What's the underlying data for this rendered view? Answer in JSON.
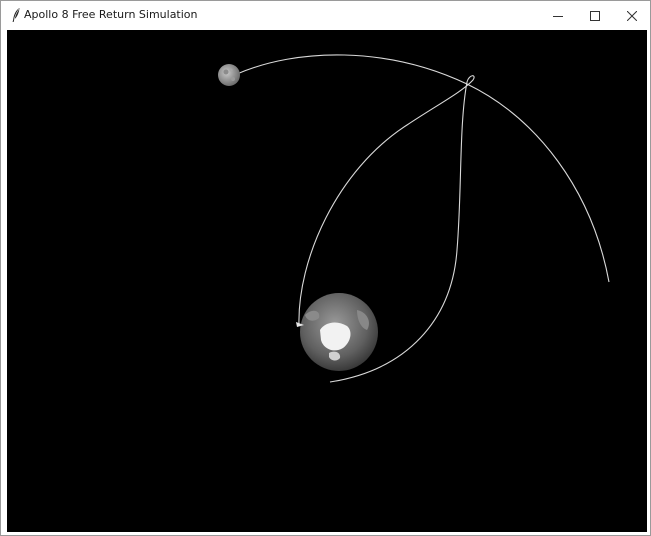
{
  "window": {
    "title": "Apollo 8 Free Return Simulation",
    "icon": "feather-icon"
  },
  "title_controls": {
    "minimize": "minimize-icon",
    "maximize": "maximize-icon",
    "close": "close-icon"
  },
  "colors": {
    "canvas_background": "#000000",
    "path": "#d9d9d9",
    "earth": "#7a7a7a",
    "moon": "#9c9c9c"
  }
}
